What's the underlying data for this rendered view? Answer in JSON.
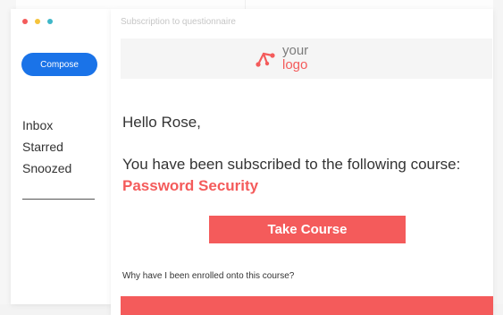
{
  "colors": {
    "accent": "#f45b5b",
    "compose_blue": "#1a73e8",
    "dot_red": "#f45b5b",
    "dot_yellow": "#f5c33b",
    "dot_teal": "#3fb7c8"
  },
  "sidebar": {
    "compose_label": "Compose",
    "items": [
      {
        "label": "Inbox"
      },
      {
        "label": "Starred"
      },
      {
        "label": "Snoozed"
      }
    ]
  },
  "email": {
    "subject": "Subscription to questionnaire",
    "logo": {
      "line1": "your",
      "line2": "logo",
      "icon": "logo-mark-icon"
    },
    "greeting": "Hello Rose,",
    "body": "You have been subscribed to the following course:",
    "course_name": "Password Security",
    "button_label": "Take Course",
    "question": "Why have I been enrolled onto this course?"
  }
}
